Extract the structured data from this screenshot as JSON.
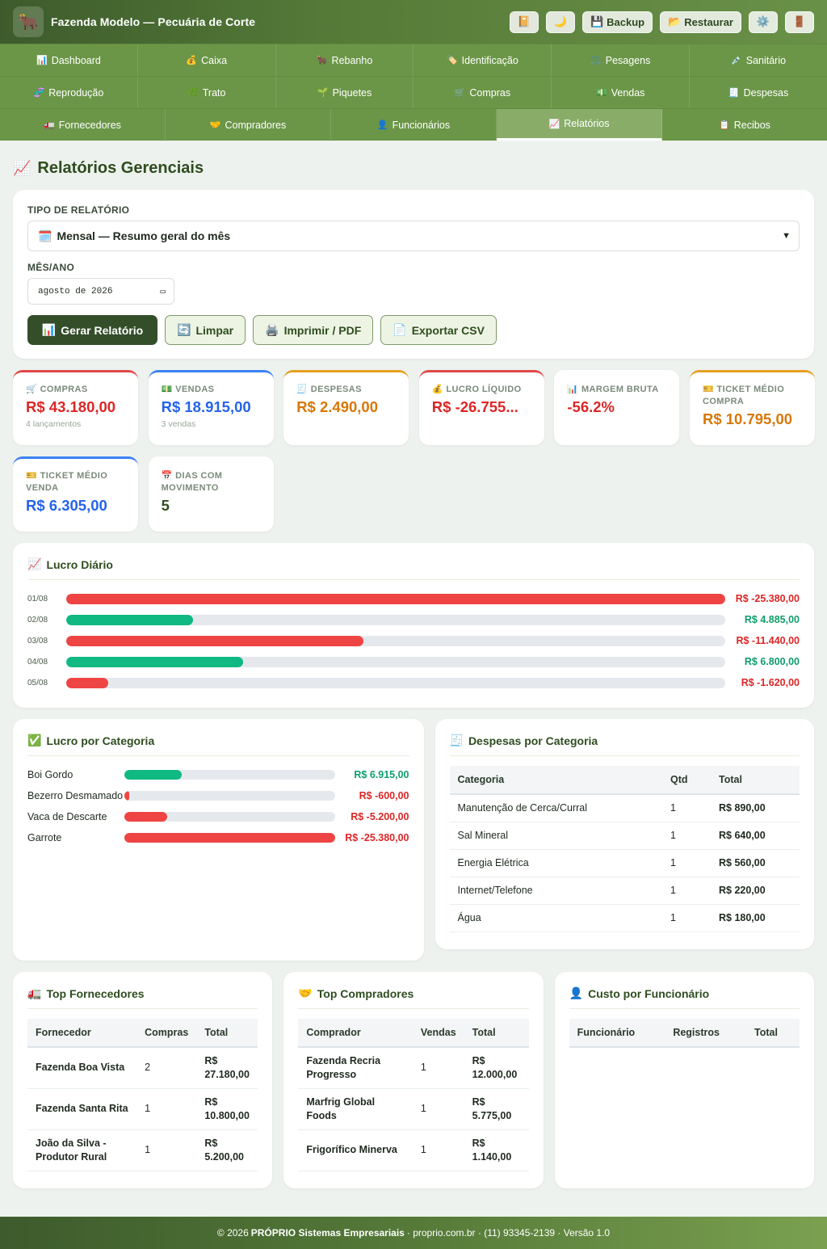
{
  "app": {
    "logo_icon": "🐂",
    "title": "Fazenda Modelo — Pecuária de Corte"
  },
  "top_actions": {
    "backup_label": "Backup",
    "restore_label": "Restaurar"
  },
  "nav": {
    "row1": [
      {
        "icon": "📊",
        "label": "Dashboard"
      },
      {
        "icon": "💰",
        "label": "Caixa"
      },
      {
        "icon": "🐂",
        "label": "Rebanho"
      },
      {
        "icon": "🏷️",
        "label": "Identificação"
      },
      {
        "icon": "⚖️",
        "label": "Pesagens"
      },
      {
        "icon": "💉",
        "label": "Sanitário"
      }
    ],
    "row2": [
      {
        "icon": "🧬",
        "label": "Reprodução"
      },
      {
        "icon": "🌿",
        "label": "Trato"
      },
      {
        "icon": "🌱",
        "label": "Piquetes"
      },
      {
        "icon": "🛒",
        "label": "Compras"
      },
      {
        "icon": "💵",
        "label": "Vendas"
      },
      {
        "icon": "🧾",
        "label": "Despesas"
      }
    ],
    "row3": [
      {
        "icon": "🚛",
        "label": "Fornecedores"
      },
      {
        "icon": "🤝",
        "label": "Compradores"
      },
      {
        "icon": "👤",
        "label": "Funcionários"
      },
      {
        "icon": "📈",
        "label": "Relatórios",
        "active": true
      },
      {
        "icon": "📋",
        "label": "Recibos"
      }
    ]
  },
  "page": {
    "title": "Relatórios Gerenciais"
  },
  "filters": {
    "type_label": "TIPO DE RELATÓRIO",
    "type_value": "Mensal — Resumo geral do mês",
    "month_label": "MÊS/ANO",
    "month_value": "agosto de 2026",
    "generate": "Gerar Relatório",
    "clear": "Limpar",
    "print": "Imprimir / PDF",
    "export": "Exportar CSV"
  },
  "kpis": {
    "compras": {
      "label": "COMPRAS",
      "value": "R$ 43.180,00",
      "sub": "4 lançamentos",
      "color": "#e04848"
    },
    "vendas": {
      "label": "VENDAS",
      "value": "R$ 18.915,00",
      "sub": "3 vendas",
      "color": "#3b82f6"
    },
    "despesas": {
      "label": "DESPESAS",
      "value": "R$ 2.490,00",
      "color": "#e5a020"
    },
    "lucro": {
      "label": "LUCRO LÍQUIDO",
      "value": "R$ -26.755...",
      "color": "#e04848"
    },
    "margem": {
      "label": "MARGEM BRUTA",
      "value": "-56.2%",
      "color": "#e04848"
    },
    "tm_compra": {
      "label": "TICKET MÉDIO COMPRA",
      "value": "R$ 10.795,00",
      "color": "#e5a020"
    },
    "tm_venda": {
      "label": "TICKET MÉDIO VENDA",
      "value": "R$ 6.305,00",
      "color": "#3b82f6"
    },
    "dias": {
      "label": "DIAS COM MOVIMENTO",
      "value": "5",
      "color": "#e04848"
    }
  },
  "daily": {
    "title": "Lucro Diário",
    "rows": [
      {
        "date": "01/08",
        "value": "R$ -25.380,00",
        "amount": -25380
      },
      {
        "date": "02/08",
        "value": "R$ 4.885,00",
        "amount": 4885
      },
      {
        "date": "03/08",
        "value": "R$ -11.440,00",
        "amount": -11440
      },
      {
        "date": "04/08",
        "value": "R$ 6.800,00",
        "amount": 6800
      },
      {
        "date": "05/08",
        "value": "R$ -1.620,00",
        "amount": -1620
      }
    ]
  },
  "profit_cat": {
    "title": "Lucro por Categoria",
    "rows": [
      {
        "name": "Boi Gordo",
        "value": "R$ 6.915,00",
        "amount": 6915
      },
      {
        "name": "Bezerro Desmamado",
        "value": "R$ -600,00",
        "amount": -600
      },
      {
        "name": "Vaca de Descarte",
        "value": "R$ -5.200,00",
        "amount": -5200
      },
      {
        "name": "Garrote",
        "value": "R$ -25.380,00",
        "amount": -25380
      }
    ]
  },
  "expenses": {
    "title": "Despesas por Categoria",
    "headers": [
      "Categoria",
      "Qtd",
      "Total"
    ],
    "rows": [
      [
        "Manutenção de Cerca/Curral",
        "1",
        "R$ 890,00"
      ],
      [
        "Sal Mineral",
        "1",
        "R$ 640,00"
      ],
      [
        "Energia Elétrica",
        "1",
        "R$ 560,00"
      ],
      [
        "Internet/Telefone",
        "1",
        "R$ 220,00"
      ],
      [
        "Água",
        "1",
        "R$ 180,00"
      ]
    ]
  },
  "suppliers": {
    "title": "Top Fornecedores",
    "headers": [
      "Fornecedor",
      "Compras",
      "Total"
    ],
    "rows": [
      [
        "Fazenda Boa Vista",
        "2",
        "R$ 27.180,00"
      ],
      [
        "Fazenda Santa Rita",
        "1",
        "R$ 10.800,00"
      ],
      [
        "João da Silva - Produtor Rural",
        "1",
        "R$ 5.200,00"
      ]
    ]
  },
  "buyers": {
    "title": "Top Compradores",
    "headers": [
      "Comprador",
      "Vendas",
      "Total"
    ],
    "rows": [
      [
        "Fazenda Recria Progresso",
        "1",
        "R$ 12.000,00"
      ],
      [
        "Marfrig Global Foods",
        "1",
        "R$ 5.775,00"
      ],
      [
        "Frigorífico Minerva",
        "1",
        "R$ 1.140,00"
      ]
    ]
  },
  "employees": {
    "title": "Custo por Funcionário",
    "headers": [
      "Funcionário",
      "Registros",
      "Total"
    ]
  },
  "footer": {
    "year": "© 2026",
    "company": "PRÓPRIO Sistemas Empresariais",
    "rest": "· proprio.com.br · (11) 93345-2139 · Versão 1.0"
  },
  "colors": {
    "positive": "#10b981",
    "negative": "#ef4444",
    "accent": "#344e2a"
  }
}
